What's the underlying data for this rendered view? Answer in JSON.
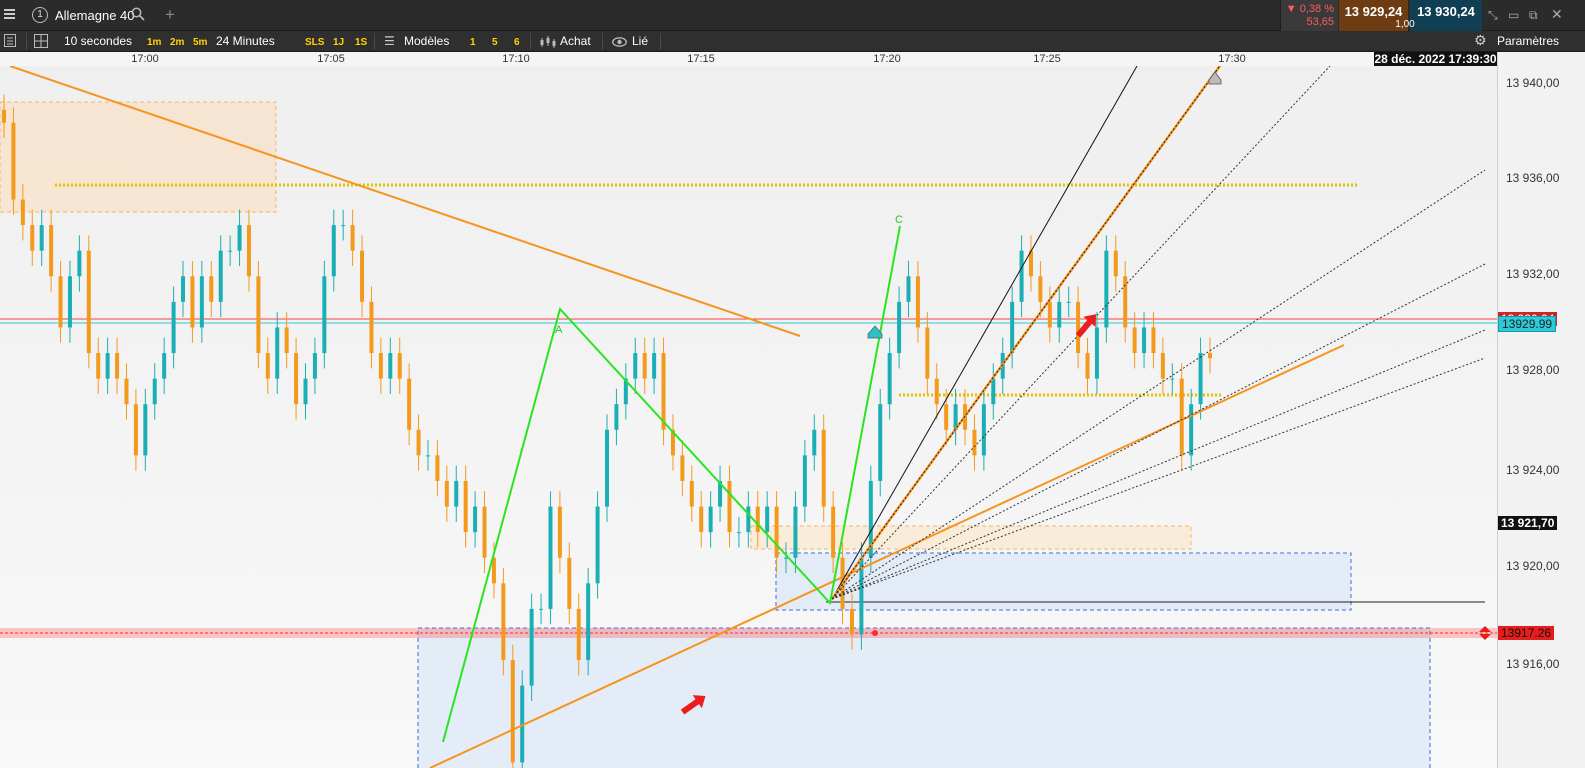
{
  "toolbar": {
    "instrument_number": "1",
    "instrument": "Allemagne 40",
    "change_pct": "▼ 0,38 %",
    "change_val": "53,65",
    "bid": "13 929,24",
    "spread": "1,00",
    "ask": "13 930,24"
  },
  "toolbar2": {
    "interval": "10 secondes",
    "quick_intervals": [
      "1m",
      "2m",
      "5m"
    ],
    "range": "24 Minutes",
    "ranges": [
      "SLS",
      "1J",
      "1S"
    ],
    "models_label": "Modèles",
    "model_slots": [
      "1",
      "5",
      "6"
    ],
    "buy_label": "Achat",
    "link_label": "Lié",
    "settings_label": "Paramètres"
  },
  "time_axis": {
    "labels": [
      "17:00",
      "17:05",
      "17:10",
      "17:15",
      "17:20",
      "17:25",
      "17:30"
    ],
    "current_datetime": "28 déc. 2022 17:39:30"
  },
  "price_axis": {
    "labels": [
      "13 940,00",
      "13 936,00",
      "13 932,00",
      "13 928,00",
      "13 924,00",
      "13 920,00",
      "13 916,00"
    ],
    "level_21_70": "13 921,70",
    "current_ask": "13929.99",
    "current_bid": "13 930,24",
    "alert_level": "13917.26"
  },
  "annotations": {
    "A": "A",
    "C": "C"
  },
  "colors": {
    "bull": "#1aafb4",
    "bear": "#f39a1c",
    "trend": "#f7941d",
    "wave": "#29e51f",
    "dotted": "#e0c200",
    "alert": "#ff2b2b"
  },
  "chart_data": {
    "type": "candlestick",
    "x_range": [
      "16:57",
      "17:39"
    ],
    "ylim": [
      13913,
      13942
    ],
    "closes": [
      13939,
      13936,
      13935,
      13934,
      13935,
      13933,
      13931,
      13933,
      13934,
      13930,
      13929,
      13930,
      13929,
      13928,
      13926,
      13928,
      13929,
      13930,
      13932,
      13933,
      13931,
      13933,
      13932,
      13934,
      13934,
      13935,
      13933,
      13930,
      13929,
      13931,
      13930,
      13928,
      13929,
      13930,
      13933,
      13935,
      13935,
      13934,
      13932,
      13930,
      13929,
      13930,
      13929,
      13927,
      13926,
      13926,
      13925,
      13924,
      13925,
      13923,
      13924,
      13922,
      13921,
      13918,
      13914,
      13917,
      13920,
      13920,
      13924,
      13922,
      13920,
      13918,
      13921,
      13924,
      13927,
      13928,
      13929,
      13930,
      13929,
      13930,
      13927,
      13926,
      13925,
      13924,
      13923,
      13924,
      13925,
      13923,
      13923,
      13924,
      13923,
      13924,
      13922,
      13922,
      13924,
      13926,
      13927,
      13924,
      13922,
      13920,
      13919,
      13922,
      13925,
      13928,
      13930,
      13932,
      13933,
      13931,
      13929,
      13928,
      13927,
      13928,
      13927,
      13926,
      13928,
      13929,
      13930,
      13932,
      13934,
      13933,
      13932,
      13931,
      13932,
      13932,
      13930,
      13929,
      13931,
      13934,
      13933,
      13931,
      13930,
      13931,
      13930,
      13929,
      13929,
      13926,
      13928,
      13930,
      13929.8
    ]
  }
}
